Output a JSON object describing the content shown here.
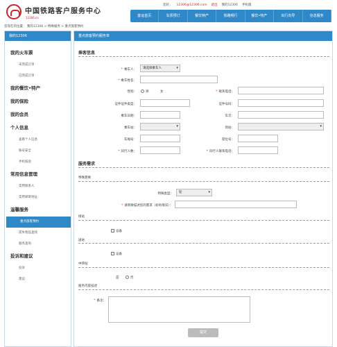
{
  "header": {
    "logo_title": "中国铁路客户服务中心",
    "logo_sub": "12306.cn",
    "user_label": "您好，",
    "user_name": "12306@12306.com",
    "logout": "退出",
    "mobile": "我的12306",
    "phone": "手机版"
  },
  "nav": [
    "客运首页",
    "车票预订",
    "餐饮特产",
    "铁路畅行",
    "餐饮•特产",
    "出行向导",
    "信息服务"
  ],
  "breadcrumb": "您现在的位置：  我的12306  >  特殊服务  >  重点旅客预约",
  "sidebar": {
    "head": "我的12306",
    "sections": [
      {
        "title": "我的火车票",
        "items": [
          "未完成订单",
          "已完成订单"
        ]
      },
      {
        "title": "我的餐饮•特产",
        "items": []
      },
      {
        "title": "我的保险",
        "items": []
      },
      {
        "title": "我的会员",
        "items": []
      },
      {
        "title": "个人信息",
        "items": [
          "查看个人信息",
          "账号安全",
          "手机核验"
        ]
      },
      {
        "title": "常用信息管理",
        "items": [
          "常用联系人",
          "常用邮寄地址"
        ]
      },
      {
        "title": "温馨服务",
        "items": [
          "重点旅客预约",
          "遗失物品查找",
          "服务查询"
        ]
      },
      {
        "title": "投诉和建议",
        "items": [
          "投诉",
          "建议"
        ]
      }
    ],
    "active_item": "重点旅客预约"
  },
  "main": {
    "head": "重点旅客预约服务单",
    "section1": "乘客信息",
    "fields": {
      "passenger": "乘车人：",
      "passenger_value": "请选择乘车人",
      "name": "乘车姓名：",
      "gender": "性别：",
      "male": "男",
      "female": "女",
      "contact": "联系电话：",
      "id_type": "证件证件类型：",
      "id_no": "证件号码：",
      "birth": "乘车日期：",
      "train": "车次：",
      "from": "乘车站：",
      "to": "到站：",
      "car": "车厢号：",
      "seat": "席位号：",
      "count": "同行人数：",
      "station": "同行人联系电话："
    },
    "section2": "服务需求",
    "special": "特殊需要",
    "service_type": "特殊类型：",
    "service_type_value": "轮",
    "desc": "请简要描述您的需求（如有情况）：",
    "group_a": "接站",
    "group_a_opt": "设备",
    "group_b": "送站",
    "group_b_opt": "设备",
    "group_c": "中转站",
    "yes": "是",
    "no": "否",
    "group_d": "服务内容描述",
    "remark": "备注：",
    "submit": "提交"
  }
}
